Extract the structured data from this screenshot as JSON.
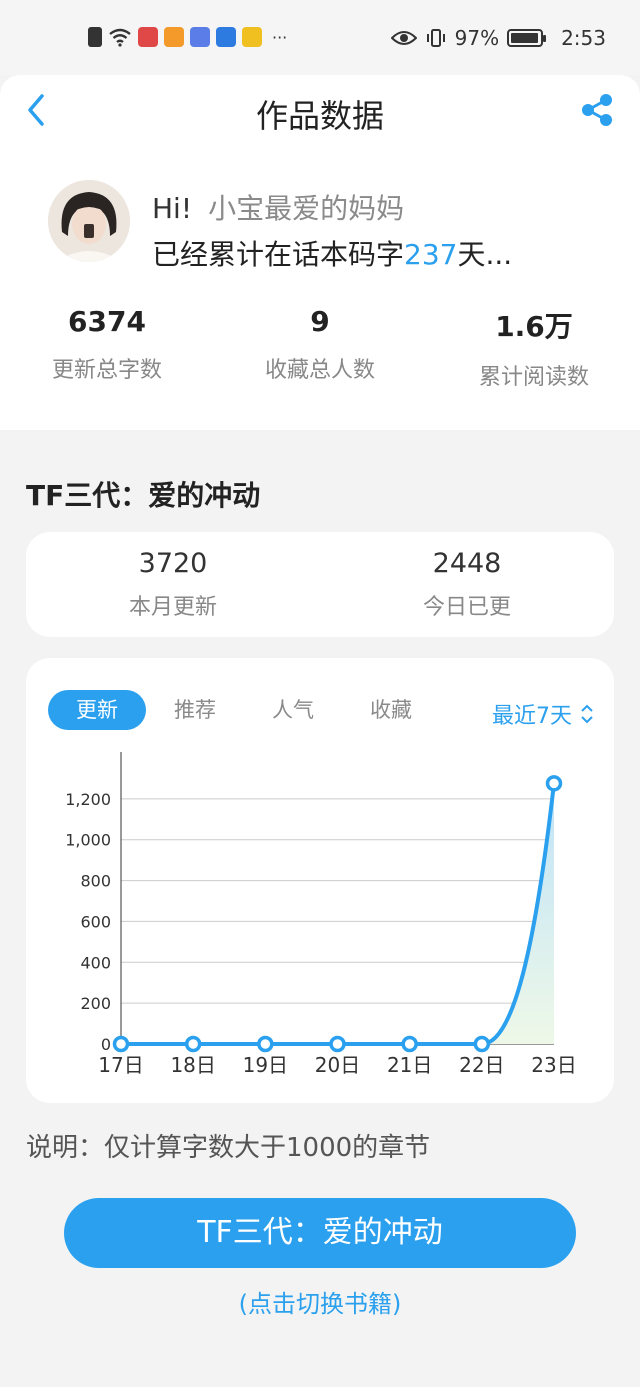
{
  "status_bar": {
    "time": "2:53",
    "battery": "97%",
    "battery_level": 0.97,
    "more": "···"
  },
  "header": {
    "title": "作品数据"
  },
  "profile": {
    "greeting": "Hi!",
    "name": "小宝最爱的妈妈",
    "days_prefix": "已经累计在话本码字",
    "days_value": "237",
    "days_suffix": "天..."
  },
  "stats": [
    {
      "value": "6374",
      "label": "更新总字数"
    },
    {
      "value": "9",
      "label": "收藏总人数"
    },
    {
      "value": "1.6万",
      "label": "累计阅读数"
    }
  ],
  "book": {
    "title": "TF三代：爱的冲动"
  },
  "updates": [
    {
      "value": "3720",
      "label": "本月更新"
    },
    {
      "value": "2448",
      "label": "今日已更"
    }
  ],
  "tabs": [
    "更新",
    "推荐",
    "人气",
    "收藏"
  ],
  "range": {
    "label": "最近7天"
  },
  "chart_data": {
    "type": "area",
    "x": [
      "17日",
      "18日",
      "19日",
      "20日",
      "21日",
      "22日",
      "23日"
    ],
    "series": [
      {
        "values": [
          0,
          0,
          0,
          0,
          0,
          0,
          1276
        ]
      }
    ],
    "yticks": [
      "0",
      "200",
      "400",
      "600",
      "800",
      "1,000",
      "1,200"
    ],
    "ylim": [
      0,
      1400
    ],
    "grid": true,
    "colors": {
      "line": "#2aa0ee",
      "fill_top": "#bfe3f8",
      "fill_bottom": "#eef8e8",
      "axis": "#333333",
      "grid": "#cccccc"
    }
  },
  "note": "说明：仅计算字数大于1000的章节",
  "cta": {
    "label": "TF三代：爱的冲动",
    "hint": "(点击切换书籍)"
  },
  "colors": {
    "accent": "#2aa0ee"
  }
}
